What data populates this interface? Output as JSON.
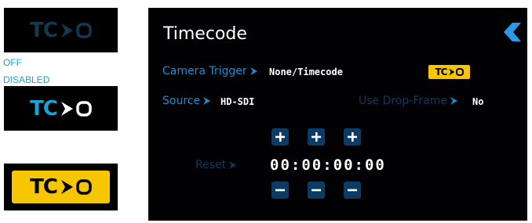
{
  "legend": {
    "off_label": "OFF",
    "disabled_label": "DISABLED",
    "badge_text": "TC"
  },
  "screen": {
    "title": "Timecode",
    "camera_trigger": {
      "label": "Camera Trigger",
      "value": "None/Timecode"
    },
    "source": {
      "label": "Source",
      "value": "HD-SDI"
    },
    "drop_frame": {
      "label": "Use Drop-Frame",
      "value": "No"
    },
    "reset": {
      "label": "Reset"
    },
    "timecode": {
      "value": "00:00:00:00"
    },
    "tc_badge_text": "TC"
  },
  "colors": {
    "accent_blue": "#1b8ed1",
    "disabled_blue": "#0e3a5e",
    "badge_yellow": "#f6c600",
    "screen_bg": "#020205"
  },
  "icons": {
    "back": "chevron-left-icon",
    "arrow": "arrow-right-icon",
    "plus": "plus-icon",
    "minus": "minus-icon",
    "record": "record-icon"
  }
}
